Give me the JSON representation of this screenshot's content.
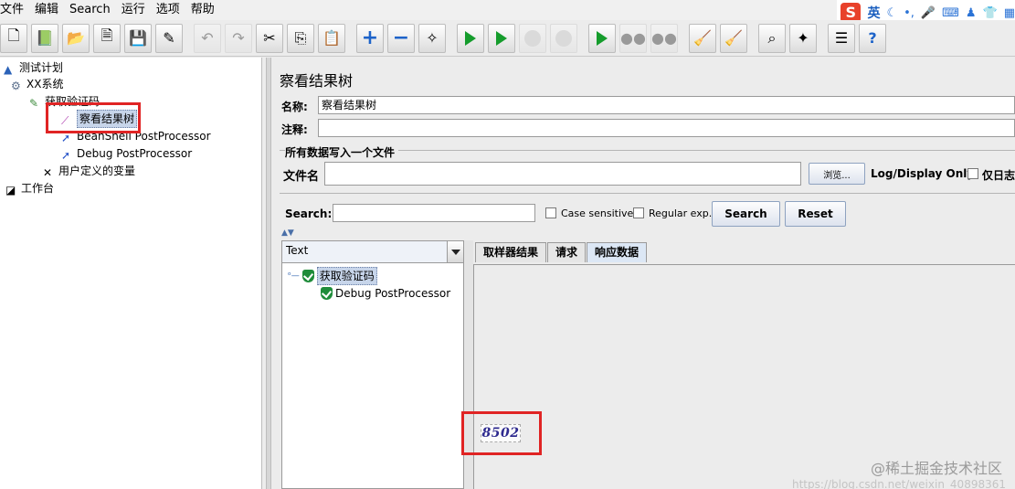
{
  "menu": [
    "文件",
    "编辑",
    "Search",
    "运行",
    "选项",
    "帮助"
  ],
  "ime": {
    "logo": "S",
    "label": "英"
  },
  "tree": {
    "test_plan": "测试计划",
    "thread_group": "XX系统",
    "sampler": "获取验证码",
    "listener": "察看结果树",
    "beanshell": "BeanShell PostProcessor",
    "debug": "Debug PostProcessor",
    "user_vars": "用户定义的变量",
    "workbench": "工作台"
  },
  "panel": {
    "title": "察看结果树",
    "name_label": "名称:",
    "name_value": "察看结果树",
    "comment_label": "注释:",
    "comment_value": "",
    "group_label": "所有数据写入一个文件",
    "file_label": "文件名",
    "file_value": "",
    "browse": "浏览...",
    "log_display": "Log/Display Only:",
    "errors_only": "仅日志",
    "search_label": "Search:",
    "search_value": "",
    "case_sensitive": "Case sensitive",
    "regular_exp": "Regular exp.",
    "search_btn": "Search",
    "reset_btn": "Reset"
  },
  "results": {
    "render_mode": "Text",
    "items": [
      "获取验证码",
      "Debug PostProcessor"
    ],
    "tabs": [
      "取样器结果",
      "请求",
      "响应数据"
    ],
    "active_tab": "响应数据",
    "captcha_text": "8502"
  },
  "watermark": "@稀土掘金技术社区",
  "watermark_url": "https://blog.csdn.net/weixin_40898361"
}
